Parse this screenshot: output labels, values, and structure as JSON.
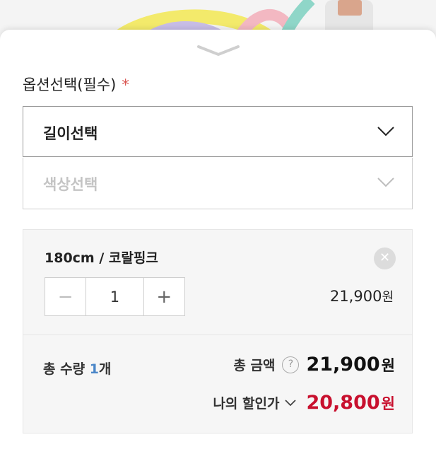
{
  "option_section": {
    "label": "옵션선택(필수)",
    "required_mark": "*"
  },
  "selects": {
    "length": "길이선택",
    "color": "색상선택"
  },
  "selected_option": {
    "name": "180cm / 코랄핑크",
    "remove_icon": "close-icon",
    "quantity": "1",
    "minus_glyph": "−",
    "plus_glyph": "+",
    "price": "21,900",
    "price_unit": "원"
  },
  "summary": {
    "total_qty_label": "총 수량",
    "total_qty_value": "1",
    "total_qty_unit": "개",
    "total_amount_label": "총 금액",
    "help_glyph": "?",
    "total_amount": "21,900",
    "total_amount_unit": "원",
    "discount_label": "나의 할인가",
    "discount_amount": "20,800",
    "discount_unit": "원"
  },
  "colors": {
    "accent_blue": "#4a86c8",
    "discount_red": "#c8102e",
    "required_red": "#d9534f"
  }
}
